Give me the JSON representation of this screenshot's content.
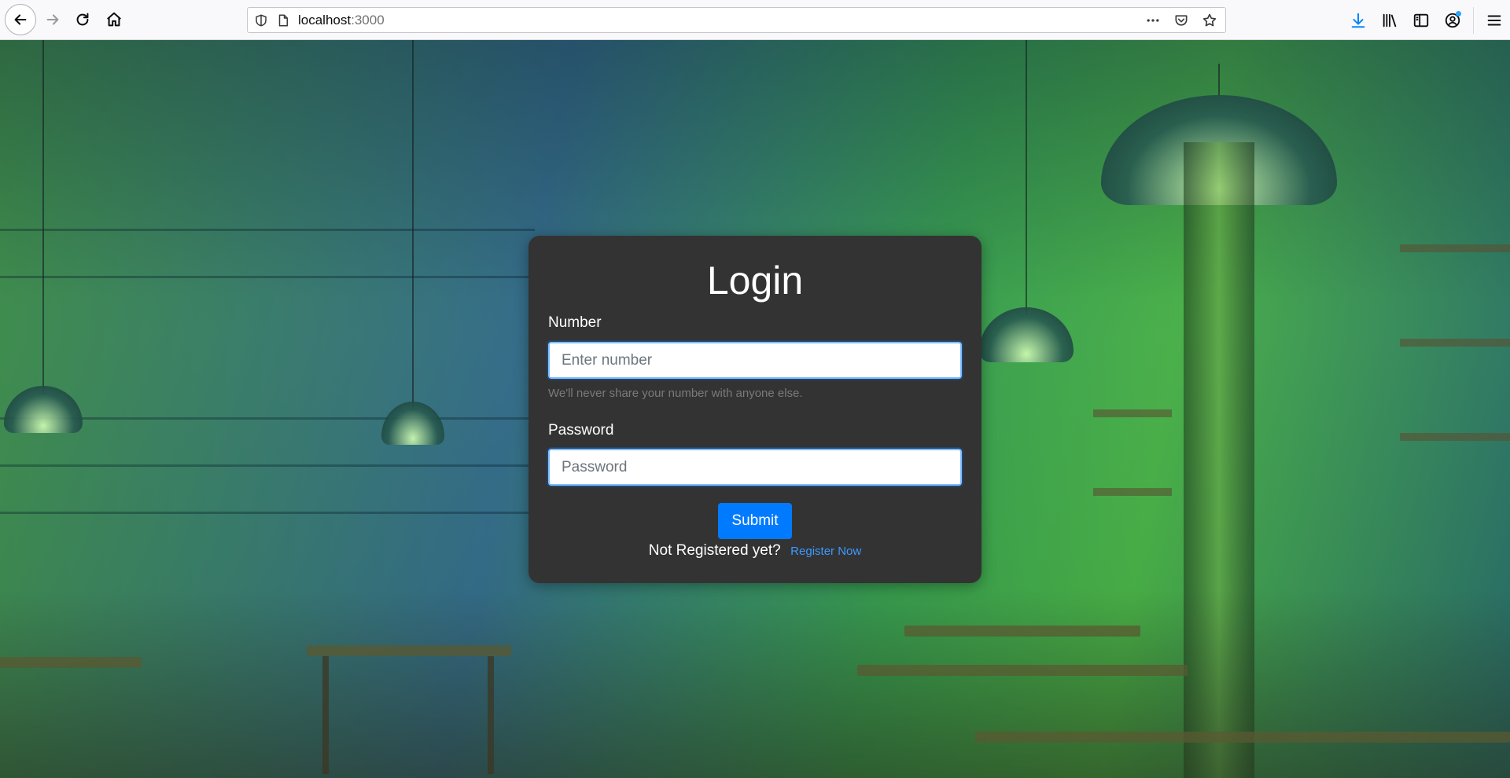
{
  "browser": {
    "url_host": "localhost",
    "url_port": ":3000",
    "icons": {
      "back": "back-arrow-icon",
      "forward": "forward-arrow-icon",
      "reload": "reload-icon",
      "home": "home-icon",
      "shield": "tracking-protection-shield-icon",
      "page": "page-info-icon",
      "more": "more-actions-icon",
      "pocket": "pocket-icon",
      "bookmark": "bookmark-star-icon",
      "downloads": "downloads-icon",
      "library": "library-icon",
      "sidebar": "sidebar-icon",
      "account": "account-icon",
      "menu": "hamburger-menu-icon"
    }
  },
  "login": {
    "title": "Login",
    "number_label": "Number",
    "number_placeholder": "Enter number",
    "number_help": "We'll never share your number with anyone else.",
    "password_label": "Password",
    "password_placeholder": "Password",
    "submit_label": "Submit",
    "not_registered_text": "Not Registered yet?",
    "register_link": "Register Now"
  },
  "colors": {
    "card_bg": "#333333",
    "primary": "#007bff",
    "link": "#3d99ff"
  }
}
